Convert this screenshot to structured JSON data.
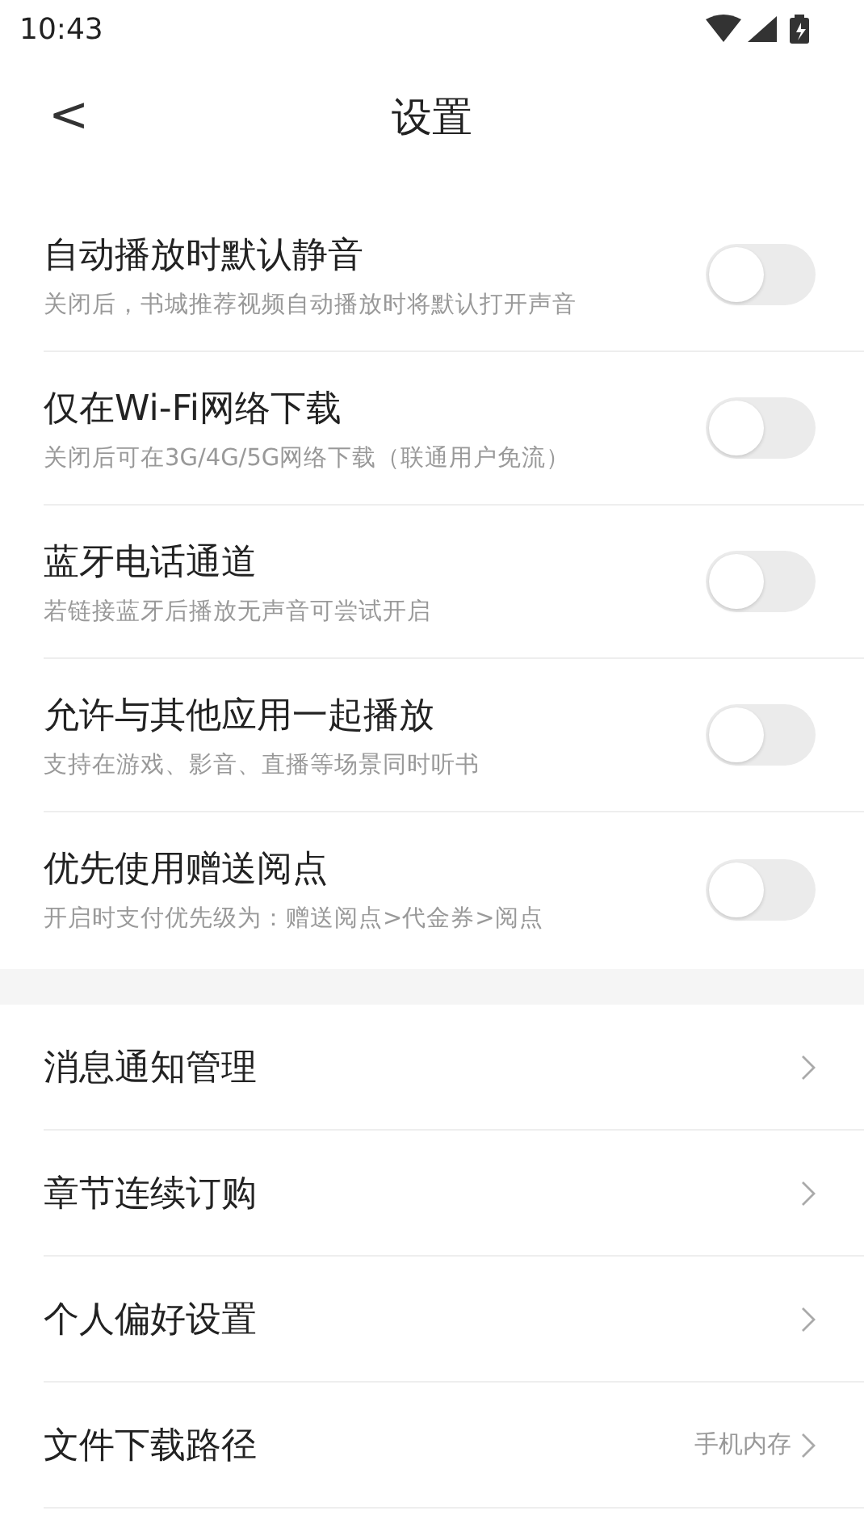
{
  "status_bar": {
    "time": "10:43"
  },
  "header": {
    "back": "<",
    "title": "设置"
  },
  "toggles": [
    {
      "title": "自动播放时默认静音",
      "subtitle": "关闭后，书城推荐视频自动播放时将默认打开声音",
      "on": false
    },
    {
      "title": "仅在Wi-Fi网络下载",
      "subtitle": "关闭后可在3G/4G/5G网络下载（联通用户免流）",
      "on": false
    },
    {
      "title": "蓝牙电话通道",
      "subtitle": "若链接蓝牙后播放无声音可尝试开启",
      "on": false
    },
    {
      "title": "允许与其他应用一起播放",
      "subtitle": "支持在游戏、影音、直播等场景同时听书",
      "on": false
    },
    {
      "title": "优先使用赠送阅点",
      "subtitle": "开启时支付优先级为：赠送阅点>代金券>阅点",
      "on": false
    }
  ],
  "links": [
    {
      "label": "消息通知管理"
    },
    {
      "label": "章节连续订购"
    },
    {
      "label": "个人偏好设置"
    },
    {
      "label": "文件下载路径",
      "value": "手机内存"
    }
  ]
}
